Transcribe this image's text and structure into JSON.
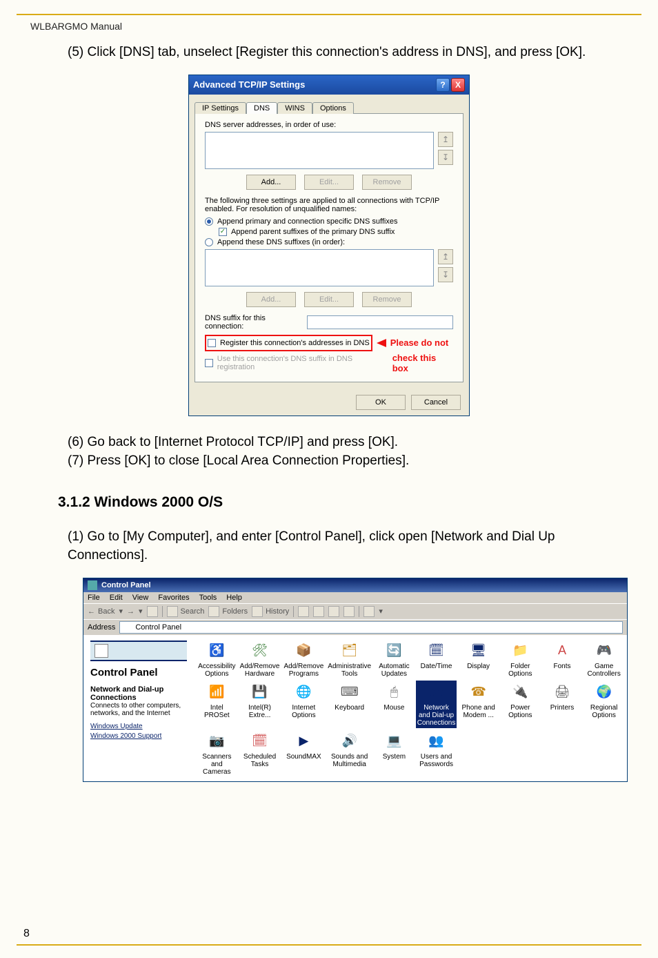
{
  "doc": {
    "header": "WLBARGMO Manual",
    "step5": "(5) Click [DNS] tab, unselect [Register this connection's address in DNS], and press [OK].",
    "step6": "(6) Go back to [Internet Protocol TCP/IP] and press [OK].",
    "step7": "(7) Press [OK] to close [Local Area Connection Properties].",
    "section": "3.1.2 Windows 2000 O/S",
    "step1": "(1) Go to [My Computer], and enter [Control Panel], click open [Network and Dial Up Connections].",
    "page": "8"
  },
  "dlg": {
    "title": "Advanced TCP/IP Settings",
    "tabs": {
      "ip": "IP Settings",
      "dns": "DNS",
      "wins": "WINS",
      "options": "Options"
    },
    "dns_servers_label": "DNS server addresses, in order of use:",
    "add": "Add...",
    "edit": "Edit...",
    "remove": "Remove",
    "three_settings": "The following three settings are applied to all connections with TCP/IP enabled. For resolution of unqualified names:",
    "radio1": "Append primary and connection specific DNS suffixes",
    "check1": "Append parent suffixes of the primary DNS suffix",
    "radio2": "Append these DNS suffixes (in order):",
    "suffix_label": "DNS suffix for this connection:",
    "register": "Register this connection's addresses in DNS",
    "use_suffix": "Use this connection's DNS suffix in DNS registration",
    "callout1": "Please do not",
    "callout2": "check this box",
    "ok": "OK",
    "cancel": "Cancel",
    "help": "?",
    "close": "X"
  },
  "cp": {
    "title": "Control Panel",
    "menu": [
      "File",
      "Edit",
      "View",
      "Favorites",
      "Tools",
      "Help"
    ],
    "toolbar": {
      "back": "Back",
      "search": "Search",
      "folders": "Folders",
      "history": "History"
    },
    "address_label": "Address",
    "address_value": "Control Panel",
    "side": {
      "heading": "Control Panel",
      "desc_head": "Network and Dial-up Connections",
      "desc": "Connects to other computers, networks, and the Internet",
      "link1": "Windows Update",
      "link2": "Windows 2000 Support"
    },
    "items": [
      {
        "label": "Accessibility Options",
        "icon": "♿",
        "cls": "ic-a"
      },
      {
        "label": "Add/Remove Hardware",
        "icon": "🛠",
        "cls": "ic-b"
      },
      {
        "label": "Add/Remove Programs",
        "icon": "📦",
        "cls": "ic-c"
      },
      {
        "label": "Administrative Tools",
        "icon": "🗂",
        "cls": "ic-c"
      },
      {
        "label": "Automatic Updates",
        "icon": "🔄",
        "cls": "ic-b"
      },
      {
        "label": "Date/Time",
        "icon": "🗓",
        "cls": "ic-h"
      },
      {
        "label": "Display",
        "icon": "🖥",
        "cls": "ic-h"
      },
      {
        "label": "Folder Options",
        "icon": "📁",
        "cls": "ic-c"
      },
      {
        "label": "Fonts",
        "icon": "A",
        "cls": "ic-e"
      },
      {
        "label": "Game Controllers",
        "icon": "🎮",
        "cls": "ic-f"
      },
      {
        "label": "Intel PROSet",
        "icon": "📶",
        "cls": "ic-b"
      },
      {
        "label": "Intel(R) Extre...",
        "icon": "💾",
        "cls": "ic-c"
      },
      {
        "label": "Internet Options",
        "icon": "🌐",
        "cls": "ic-a"
      },
      {
        "label": "Keyboard",
        "icon": "⌨",
        "cls": "ic-f"
      },
      {
        "label": "Mouse",
        "icon": "🖱",
        "cls": "ic-f"
      },
      {
        "label": "Network and Dial-up Connections",
        "icon": "🖧",
        "cls": "ic-h",
        "sel": true
      },
      {
        "label": "Phone and Modem ...",
        "icon": "☎",
        "cls": "ic-c"
      },
      {
        "label": "Power Options",
        "icon": "🔌",
        "cls": "ic-b"
      },
      {
        "label": "Printers",
        "icon": "🖨",
        "cls": "ic-f"
      },
      {
        "label": "Regional Options",
        "icon": "🌍",
        "cls": "ic-b"
      },
      {
        "label": "Scanners and Cameras",
        "icon": "📷",
        "cls": "ic-c"
      },
      {
        "label": "Scheduled Tasks",
        "icon": "🗓",
        "cls": "ic-e"
      },
      {
        "label": "SoundMAX",
        "icon": "▶",
        "cls": "ic-h"
      },
      {
        "label": "Sounds and Multimedia",
        "icon": "🔊",
        "cls": "ic-c"
      },
      {
        "label": "System",
        "icon": "💻",
        "cls": "ic-a"
      },
      {
        "label": "Users and Passwords",
        "icon": "👥",
        "cls": "ic-c"
      }
    ]
  }
}
